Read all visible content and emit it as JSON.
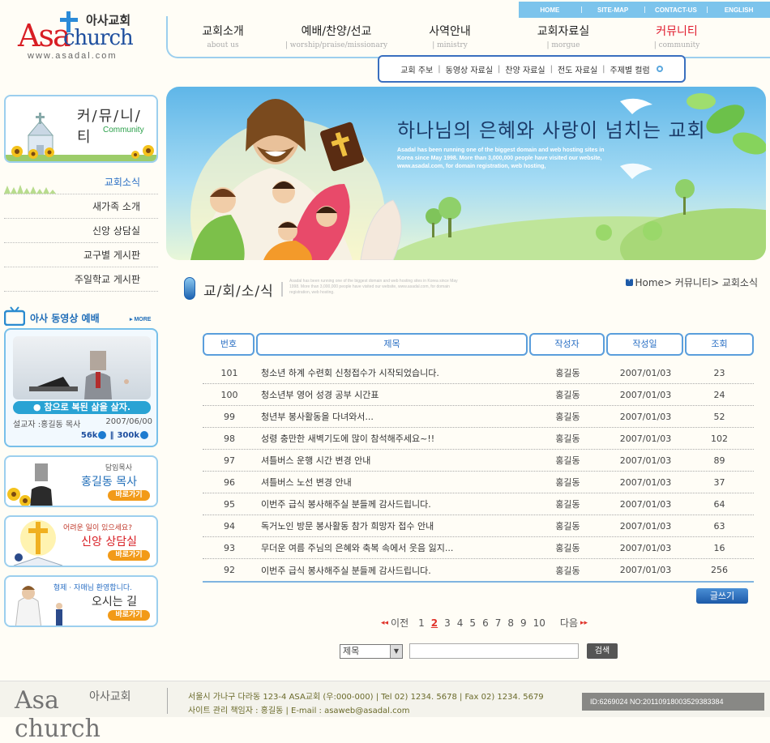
{
  "util_nav": [
    "HOME",
    "SITE-MAP",
    "CONTACT-US",
    "ENGLISH"
  ],
  "logo": {
    "asa": "Asa",
    "church": "church",
    "korean": "아사교회",
    "url": "www.asadal.com"
  },
  "gnb": [
    {
      "ko": "교회소개",
      "en": "about us"
    },
    {
      "ko": "예배/찬양/선교",
      "en": "| worship/praise/missionary"
    },
    {
      "ko": "사역안내",
      "en": "| ministry"
    },
    {
      "ko": "교회자료실",
      "en": "| morgue"
    },
    {
      "ko": "커뮤니티",
      "en": "| community"
    }
  ],
  "subnav": [
    "교회 주보",
    "동영상 자료실",
    "찬양 자료실",
    "전도 자료실",
    "주제별 컬럼"
  ],
  "community_box": {
    "title": "커/뮤/니/티",
    "subtitle": "Community"
  },
  "lnb": [
    "교회소식",
    "새가족 소개",
    "신앙 상담실",
    "교구별 게시판",
    "주일학교 게시판"
  ],
  "video": {
    "heading": "아사 동영상 예배",
    "more": "MORE",
    "caption": "● 참으로 복된 삶을 살자.",
    "preacher": "설교자 :홍길동 목사",
    "date": "2007/06/00",
    "rate1": "56k",
    "rate2": "300k"
  },
  "banners": [
    {
      "line1": "담임목사",
      "line2": "홍길동 목사",
      "go": "바로가기"
    },
    {
      "line1": "어려운 일이 있으세요?",
      "line2": "신앙 상담실",
      "go": "바로가기"
    },
    {
      "line1": "형제 · 자매님 환영합니다.",
      "line2": "오시는 길",
      "go": "바로가기"
    }
  ],
  "hero": {
    "slogan": "하나님의 은혜와 사랑이 넘치는 교회",
    "desc": "Asadal has been running one of the biggest domain and web hosting sites in Korea since May 1998. More than 3,000,000 people have visited our website, www.asadal.com, for domain registration, web hosting,"
  },
  "page_title": {
    "title": "교/회/소/식",
    "small": "Asadal has been running one of the biggest domain and web hosting sites in Korea since May 1998. More than 3,000,000 people have visited our website, www.asadal.com, for domain registration, web hosting.",
    "breadcrumb": "Home> 커뮤니티> 교회소식"
  },
  "board": {
    "headers": [
      "번호",
      "제목",
      "작성자",
      "작성일",
      "조회"
    ],
    "rows": [
      {
        "no": "101",
        "title": "청소년 하계 수련회 신청접수가 시작되었습니다.",
        "author": "홍길동",
        "date": "2007/01/03",
        "views": "23"
      },
      {
        "no": "100",
        "title": "청소년부 영어 성경 공부 시간표",
        "author": "홍길동",
        "date": "2007/01/03",
        "views": "24"
      },
      {
        "no": "99",
        "title": "청년부 봉사활동을 다녀와서...",
        "author": "홍길동",
        "date": "2007/01/03",
        "views": "52"
      },
      {
        "no": "98",
        "title": "성령 충만한 새벽기도에 많이 참석해주세요~!!",
        "author": "홍길동",
        "date": "2007/01/03",
        "views": "102"
      },
      {
        "no": "97",
        "title": "셔틀버스 운행 시간 변경 안내",
        "author": "홍길동",
        "date": "2007/01/03",
        "views": "89"
      },
      {
        "no": "96",
        "title": "셔틀버스 노선 변경 안내",
        "author": "홍길동",
        "date": "2007/01/03",
        "views": "37"
      },
      {
        "no": "95",
        "title": "이번주 급식 봉사해주실 분들께 감사드립니다.",
        "author": "홍길동",
        "date": "2007/01/03",
        "views": "64"
      },
      {
        "no": "94",
        "title": "독거노인 방문 봉사활동 참가 희망자 접수 안내",
        "author": "홍길동",
        "date": "2007/01/03",
        "views": "63"
      },
      {
        "no": "93",
        "title": "무더운 여름 주님의 은혜와 축복 속에서 웃음 잃지...",
        "author": "홍길동",
        "date": "2007/01/03",
        "views": "16"
      },
      {
        "no": "92",
        "title": "이번주 급식 봉사해주실 분들께 감사드립니다.",
        "author": "홍길동",
        "date": "2007/01/03",
        "views": "256"
      }
    ],
    "write_button": "글쓰기"
  },
  "pager": {
    "prev": "이전",
    "next": "다음",
    "pages": [
      "1",
      "2",
      "3",
      "4",
      "5",
      "6",
      "7",
      "8",
      "9",
      "10"
    ],
    "current": "2"
  },
  "search": {
    "select": "제목",
    "button": "검색",
    "value": ""
  },
  "footer": {
    "logo_text": "Asa church",
    "logo_kor": "아사교회",
    "line1": "서울시 가나구 다라동 123-4 ASA교회 (우:000-000) | Tel 02) 1234. 5678 | Fax 02) 1234. 5679",
    "line2": "사이트 관리 책임자 : 홍길동 | E-mail : asaweb@asadal.com",
    "watermark": "ID:6269024 NO:20110918003529383384"
  },
  "colors": {
    "accent": "#2a6fc4",
    "active_menu": "#e01a2c",
    "util_bar": "#7cc4ec",
    "border": "#9ccfee"
  }
}
